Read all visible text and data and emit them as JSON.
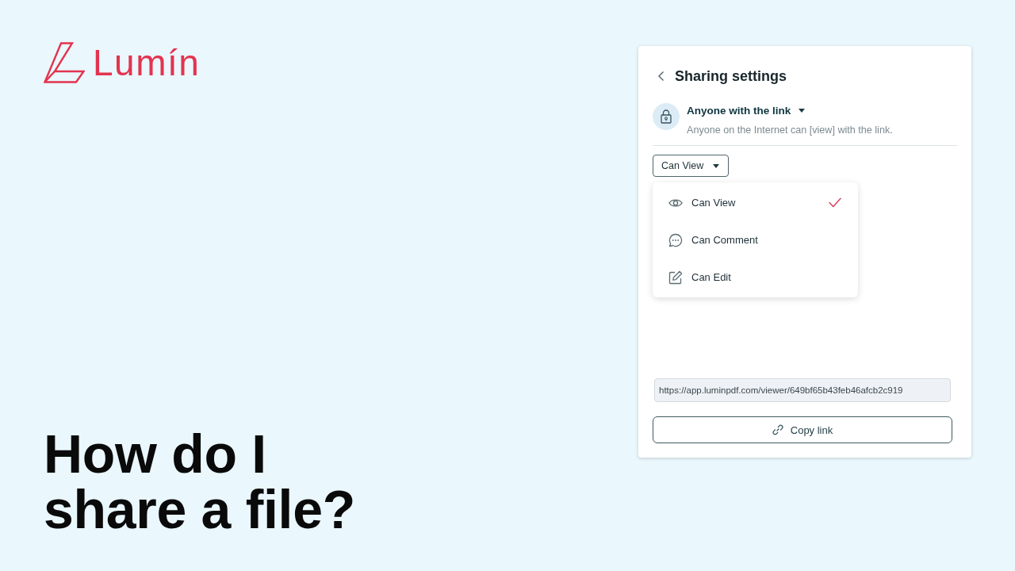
{
  "logo": {
    "name": "Lumín"
  },
  "headline": "How do I share a file?",
  "sharing_panel": {
    "title": "Sharing settings",
    "access": {
      "label": "Anyone with the link",
      "description": "Anyone on the Internet can [view] with the link."
    },
    "permission_dropdown": {
      "value": "Can View",
      "expanded": true
    },
    "permission_menu": [
      {
        "kind": "view",
        "label": "Can View",
        "selected": true
      },
      {
        "kind": "comment",
        "label": "Can Comment",
        "selected": false
      },
      {
        "kind": "edit",
        "label": "Can Edit",
        "selected": false
      }
    ],
    "link_field": {
      "value": "https://app.luminpdf.com/viewer/649bf65b43feb46afcb2c919"
    },
    "copy_button": "Copy link"
  }
}
